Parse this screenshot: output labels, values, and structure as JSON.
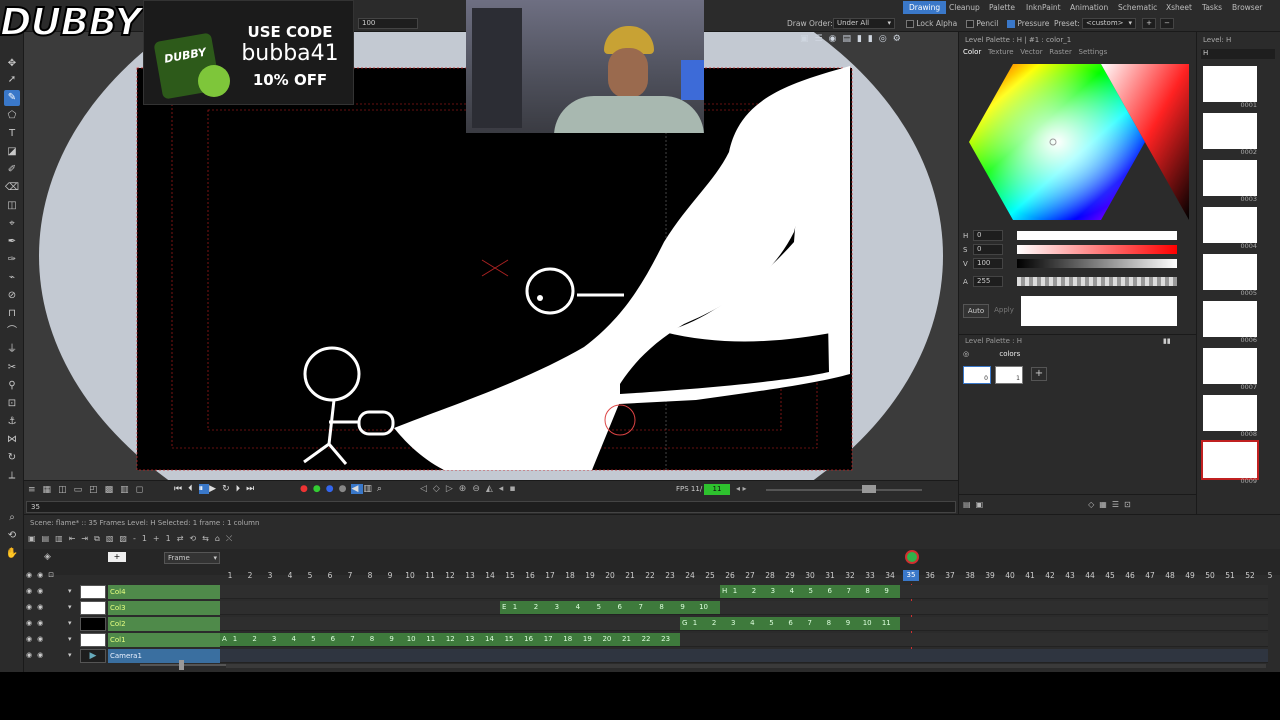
{
  "app": {
    "menus": [
      {
        "label": "Drawing",
        "active": true
      },
      {
        "label": "Cleanup"
      },
      {
        "label": "Palette"
      },
      {
        "label": "InknPaint"
      },
      {
        "label": "Animation"
      },
      {
        "label": "Schematic"
      },
      {
        "label": "Xsheet"
      },
      {
        "label": "Tasks"
      },
      {
        "label": "Browser"
      }
    ],
    "toolbar": {
      "size_value": "100",
      "draw_order_label": "Draw Order:",
      "draw_order_value": "Under All",
      "lock_alpha_label": "Lock Alpha",
      "pencil_label": "Pencil",
      "pressure_label": "Pressure",
      "preset_label": "Preset:",
      "preset_value": "<custom>"
    }
  },
  "overlay": {
    "brand": "DUBBY",
    "promo_line1": "USE CODE",
    "promo_code": "bubba41",
    "promo_line3": "10% OFF",
    "can_label": "DUBBY"
  },
  "viewer": {
    "fps_label": "FPS 11/",
    "fps_value": "11",
    "frame_field": "35"
  },
  "style_panel": {
    "title": "Level Palette : H | #1 : color_1",
    "tabs": [
      "Color",
      "Texture",
      "Vector",
      "Raster",
      "Settings"
    ],
    "sliders": [
      {
        "label": "H",
        "value": "0"
      },
      {
        "label": "S",
        "value": "0"
      },
      {
        "label": "V",
        "value": "100"
      },
      {
        "label": "A",
        "value": "255"
      }
    ],
    "auto_label": "Auto",
    "apply_label": "Apply",
    "palette_title": "Level Palette : H",
    "palette_name": "colors",
    "chip_0": "0",
    "chip_1": "1"
  },
  "level_strip": {
    "title": "Level: H",
    "level_name": "H",
    "frames": [
      "0001",
      "0002",
      "0003",
      "0004",
      "0005",
      "0006",
      "0007",
      "0008",
      "0009"
    ]
  },
  "xsheet": {
    "status": "Scene: flame*  ::  35 Frames Level: H  Selected: 1 frame : 1 column",
    "frame_dropdown": "Frame",
    "columns": [
      {
        "name": "Col4",
        "run_label": "H",
        "start": 26,
        "end": 34
      },
      {
        "name": "Col3",
        "run_label": "E",
        "start": 15,
        "end": 25
      },
      {
        "name": "Col2",
        "run_label": "G",
        "start": 24,
        "end": 34
      },
      {
        "name": "Col1",
        "run_label": "A",
        "start": 1,
        "end": 23
      },
      {
        "name": "Camera1"
      }
    ],
    "ruler": [
      "1",
      "2",
      "3",
      "4",
      "5",
      "6",
      "7",
      "8",
      "9",
      "10",
      "11",
      "12",
      "13",
      "14",
      "15",
      "16",
      "17",
      "18",
      "19",
      "20",
      "21",
      "22",
      "23",
      "24",
      "25",
      "26",
      "27",
      "28",
      "29",
      "30",
      "31",
      "32",
      "33",
      "34",
      "35",
      "36",
      "37",
      "38",
      "39",
      "40",
      "41",
      "42",
      "43",
      "44",
      "45",
      "46",
      "47",
      "48",
      "49",
      "50",
      "51",
      "52",
      "5"
    ],
    "current_frame": "35",
    "col4_cells": [
      "1",
      "2",
      "3",
      "4",
      "5",
      "6",
      "7",
      "8",
      "9"
    ],
    "col3_cells": [
      "1",
      "2",
      "3",
      "4",
      "5",
      "6",
      "7",
      "8",
      "9",
      "10"
    ],
    "col2_cells": [
      "1",
      "2",
      "3",
      "4",
      "5",
      "6",
      "7",
      "8",
      "9",
      "10",
      "11"
    ],
    "col1_cells": [
      "1",
      "2",
      "3",
      "4",
      "5",
      "6",
      "7",
      "8",
      "9",
      "10",
      "11",
      "12",
      "13",
      "14",
      "15",
      "16",
      "17",
      "18",
      "19",
      "20",
      "21",
      "22",
      "23"
    ]
  },
  "colors": {
    "accent": "#3a78c9",
    "column_green": "#4f8a4a",
    "camera_blue": "#3a6fa0",
    "playhead": "#d03030"
  }
}
